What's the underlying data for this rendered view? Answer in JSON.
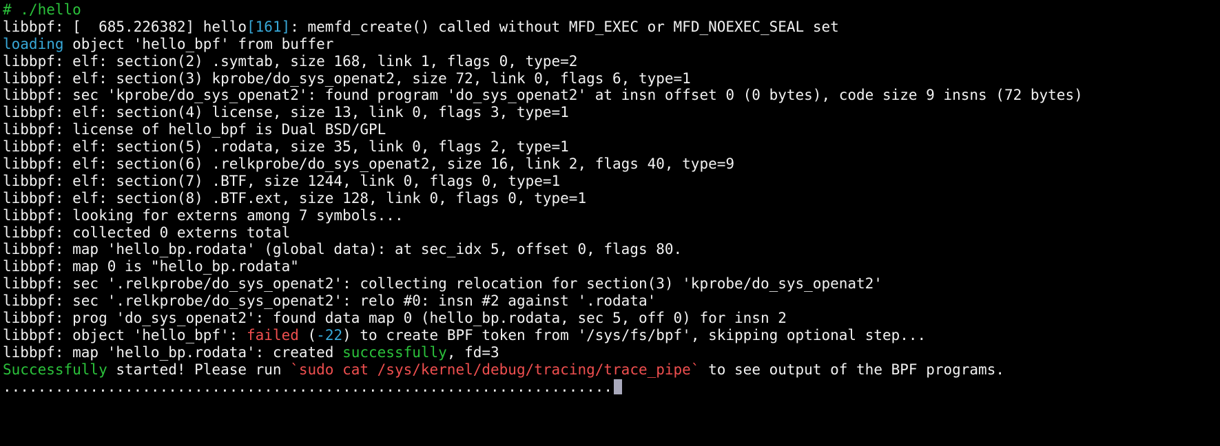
{
  "colors": {
    "background": "#000000",
    "default_text": "#f2f2f2",
    "green": "#2bc23b",
    "cyan": "#38a8d8",
    "red": "#ef4f4f",
    "cursor": "#a9a9bc"
  },
  "terminal": {
    "lines": [
      [
        {
          "t": "# ./hello",
          "c": "green"
        }
      ],
      [
        {
          "t": "libbpf: [  685.226382] hello"
        },
        {
          "t": "[161]",
          "c": "cyan"
        },
        {
          "t": ": memfd_create() called without MFD_EXEC or MFD_NOEXEC_SEAL set"
        }
      ],
      [
        {
          "t": "loading",
          "c": "cyan"
        },
        {
          "t": " object 'hello_bpf' from buffer"
        }
      ],
      [
        {
          "t": "libbpf: elf: section(2) .symtab, size 168, link 1, flags 0, type=2"
        }
      ],
      [
        {
          "t": "libbpf: elf: section(3) kprobe/do_sys_openat2, size 72, link 0, flags 6, type=1"
        }
      ],
      [
        {
          "t": "libbpf: sec 'kprobe/do_sys_openat2': found program 'do_sys_openat2' at insn offset 0 (0 bytes), code size 9 insns (72 bytes)"
        }
      ],
      [
        {
          "t": "libbpf: elf: section(4) license, size 13, link 0, flags 3, type=1"
        }
      ],
      [
        {
          "t": "libbpf: license of hello_bpf is Dual BSD/GPL"
        }
      ],
      [
        {
          "t": "libbpf: elf: section(5) .rodata, size 35, link 0, flags 2, type=1"
        }
      ],
      [
        {
          "t": "libbpf: elf: section(6) .relkprobe/do_sys_openat2, size 16, link 2, flags 40, type=9"
        }
      ],
      [
        {
          "t": "libbpf: elf: section(7) .BTF, size 1244, link 0, flags 0, type=1"
        }
      ],
      [
        {
          "t": "libbpf: elf: section(8) .BTF.ext, size 128, link 0, flags 0, type=1"
        }
      ],
      [
        {
          "t": "libbpf: looking for externs among 7 symbols..."
        }
      ],
      [
        {
          "t": "libbpf: collected 0 externs total"
        }
      ],
      [
        {
          "t": "libbpf: map 'hello_bp.rodata' (global data): at sec_idx 5, offset 0, flags 80."
        }
      ],
      [
        {
          "t": "libbpf: map 0 is \"hello_bp.rodata\""
        }
      ],
      [
        {
          "t": "libbpf: sec '.relkprobe/do_sys_openat2': collecting relocation for section(3) 'kprobe/do_sys_openat2'"
        }
      ],
      [
        {
          "t": "libbpf: sec '.relkprobe/do_sys_openat2': relo #0: insn #2 against '.rodata'"
        }
      ],
      [
        {
          "t": "libbpf: prog 'do_sys_openat2': found data map 0 (hello_bp.rodata, sec 5, off 0) for insn 2"
        }
      ],
      [
        {
          "t": "libbpf: object 'hello_bpf': "
        },
        {
          "t": "failed",
          "c": "red"
        },
        {
          "t": " ("
        },
        {
          "t": "-22",
          "c": "cyan"
        },
        {
          "t": ") to create BPF token from '/sys/fs/bpf', skipping optional step..."
        }
      ],
      [
        {
          "t": "libbpf: map 'hello_bp.rodata': created "
        },
        {
          "t": "successfully",
          "c": "green"
        },
        {
          "t": ", fd=3"
        }
      ],
      [
        {
          "t": "Successfully",
          "c": "green"
        },
        {
          "t": " started! Please run "
        },
        {
          "t": "`sudo cat /sys/kernel/debug/tracing/trace_pipe`",
          "c": "red"
        },
        {
          "t": " to see output of the BPF programs."
        }
      ],
      [
        {
          "t": "......................................................................"
        },
        {
          "cursor": true
        }
      ]
    ]
  }
}
